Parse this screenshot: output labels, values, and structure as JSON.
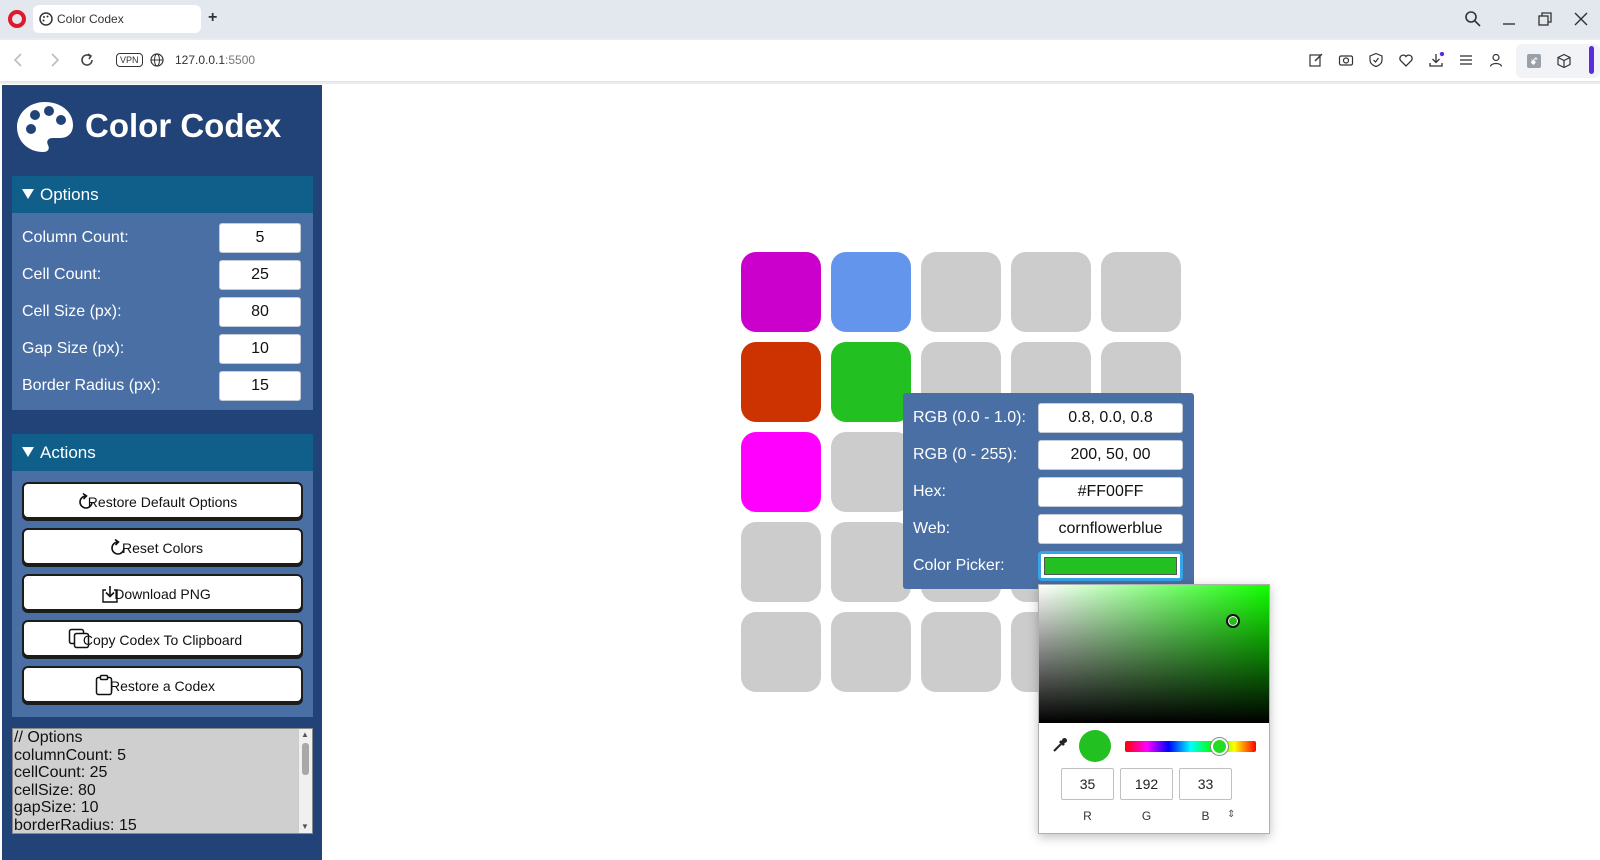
{
  "browser": {
    "tab_title": "Color Codex",
    "new_tab": "+",
    "vpn": "VPN",
    "url_host": "127.0.0.1",
    "url_port": ":5500"
  },
  "app": {
    "title": "Color Codex"
  },
  "options": {
    "header": "Options",
    "fields": [
      {
        "label": "Column Count:",
        "value": "5"
      },
      {
        "label": "Cell Count:",
        "value": "25"
      },
      {
        "label": "Cell Size (px):",
        "value": "80"
      },
      {
        "label": "Gap Size (px):",
        "value": "10"
      },
      {
        "label": "Border Radius (px):",
        "value": "15"
      }
    ]
  },
  "actions": {
    "header": "Actions",
    "buttons": [
      {
        "label": "Restore Default Options",
        "icon": "refresh-icon"
      },
      {
        "label": "Reset Colors",
        "icon": "refresh-icon"
      },
      {
        "label": "Download PNG",
        "icon": "download-icon"
      },
      {
        "label": "Copy Codex To Clipboard",
        "icon": "copy-icon"
      },
      {
        "label": "Restore a Codex",
        "icon": "clipboard-icon"
      }
    ]
  },
  "codex": {
    "lines": [
      "// Options",
      "columnCount: 5",
      "cellCount: 25",
      "cellSize: 80",
      "gapSize: 10",
      "borderRadius: 15"
    ]
  },
  "grid": {
    "cells": [
      "#cc00cc",
      "#6495ed",
      "#cccccc",
      "#cccccc",
      "#cccccc",
      "#cc3300",
      "#23c021",
      "#cccccc",
      "#cccccc",
      "#cccccc",
      "#ff00ff",
      "#cccccc",
      "#cccccc",
      "#cccccc",
      "#cccccc",
      "#cccccc",
      "#cccccc",
      "#cccccc",
      "#cccccc",
      "#cccccc",
      "#cccccc",
      "#cccccc",
      "#cccccc",
      "#cccccc",
      "#cccccc"
    ]
  },
  "color_popup": {
    "rgb_float_label": "RGB (0.0 - 1.0):",
    "rgb_float_value": "0.8, 0.0, 0.8",
    "rgb_int_label": "RGB (0 - 255):",
    "rgb_int_value": "200, 50, 00",
    "hex_label": "Hex:",
    "hex_value": "#FF00FF",
    "web_label": "Web:",
    "web_value": "cornflowerblue",
    "picker_label": "Color Picker:",
    "picker_color": "#23c021"
  },
  "color_picker": {
    "r": "35",
    "g": "192",
    "b": "33",
    "r_label": "R",
    "g_label": "G",
    "b_label": "B",
    "mode_toggle": "⇕"
  },
  "colors": {
    "sidebar_bg": "#224377",
    "panel_bg": "#4a6fa4",
    "panel_header_bg": "#0f5f8a",
    "empty_cell": "#cccccc"
  }
}
